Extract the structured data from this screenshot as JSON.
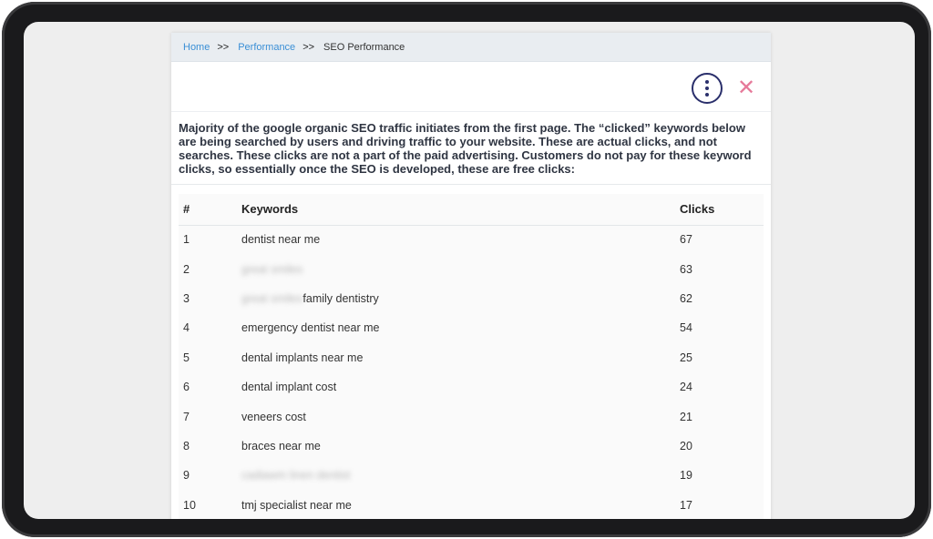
{
  "breadcrumb": {
    "items": [
      {
        "label": "Home",
        "link": true
      },
      {
        "label": "Performance",
        "link": true
      },
      {
        "label": "SEO Performance",
        "link": false
      }
    ],
    "separator": ">>"
  },
  "toolbar": {
    "menu_icon": "vertical-dots-icon",
    "close_icon": "close-icon",
    "close_glyph": "✕",
    "accent_color": "#2a2f6b",
    "close_color": "#e67a9a"
  },
  "intro_text": "Majority of the google organic SEO traffic initiates from the first page. The “clicked” keywords below are being searched by users and driving traffic to your website. These are actual clicks, and not searches. These clicks are not a part of the paid advertising. Customers do not pay for these keyword clicks, so essentially once the SEO is developed, these are free clicks:",
  "table": {
    "headers": [
      "#",
      "Keywords",
      "Clicks"
    ],
    "rows": [
      {
        "num": "1",
        "blurred": "",
        "keyword": "dentist near me",
        "clicks": "67"
      },
      {
        "num": "2",
        "blurred": "great smiles",
        "keyword": "",
        "clicks": "63"
      },
      {
        "num": "3",
        "blurred": "great smiles",
        "keyword": "family dentistry",
        "clicks": "62"
      },
      {
        "num": "4",
        "blurred": "",
        "keyword": "emergency dentist near me",
        "clicks": "54"
      },
      {
        "num": "5",
        "blurred": "",
        "keyword": "dental implants near me",
        "clicks": "25"
      },
      {
        "num": "6",
        "blurred": "",
        "keyword": "dental implant cost",
        "clicks": "24"
      },
      {
        "num": "7",
        "blurred": "",
        "keyword": "veneers cost",
        "clicks": "21"
      },
      {
        "num": "8",
        "blurred": "",
        "keyword": "braces near me",
        "clicks": "20"
      },
      {
        "num": "9",
        "blurred": "cadiawm linen dentist",
        "keyword": "",
        "clicks": "19"
      },
      {
        "num": "10",
        "blurred": "",
        "keyword": "tmj specialist near me",
        "clicks": "17"
      }
    ]
  }
}
